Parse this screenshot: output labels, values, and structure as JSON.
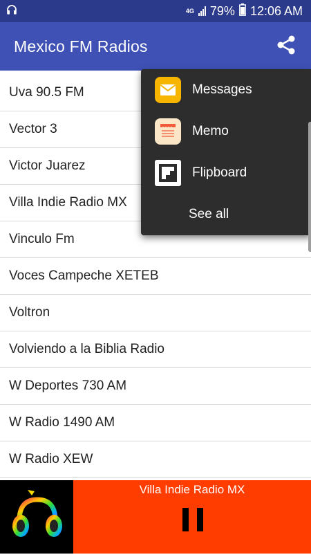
{
  "status_bar": {
    "network": "4G",
    "battery": "79%",
    "time": "12:06 AM"
  },
  "app_bar": {
    "title": "Mexico FM Radios"
  },
  "stations": [
    "Uva 90.5 FM",
    "Vector 3",
    "Victor Juarez",
    "Villa Indie Radio MX",
    "Vinculo Fm",
    "Voces Campeche XETEB",
    "Voltron",
    "Volviendo a la Biblia Radio",
    "W Deportes 730 AM",
    "W Radio 1490 AM",
    "W Radio XEW"
  ],
  "share_menu": {
    "items": [
      {
        "label": "Messages",
        "icon": "messages-icon",
        "color": "#f7b500"
      },
      {
        "label": "Memo",
        "icon": "memo-icon",
        "color": "#fbe6c7"
      },
      {
        "label": "Flipboard",
        "icon": "flipboard-icon",
        "color": "#ffffff"
      },
      {
        "label": "See all"
      }
    ]
  },
  "player": {
    "now_playing": "Villa Indie Radio MX",
    "accent_color": "#ff3d00"
  },
  "colors": {
    "status_bar": "#2c3a8c",
    "app_bar": "#3f51b5"
  }
}
